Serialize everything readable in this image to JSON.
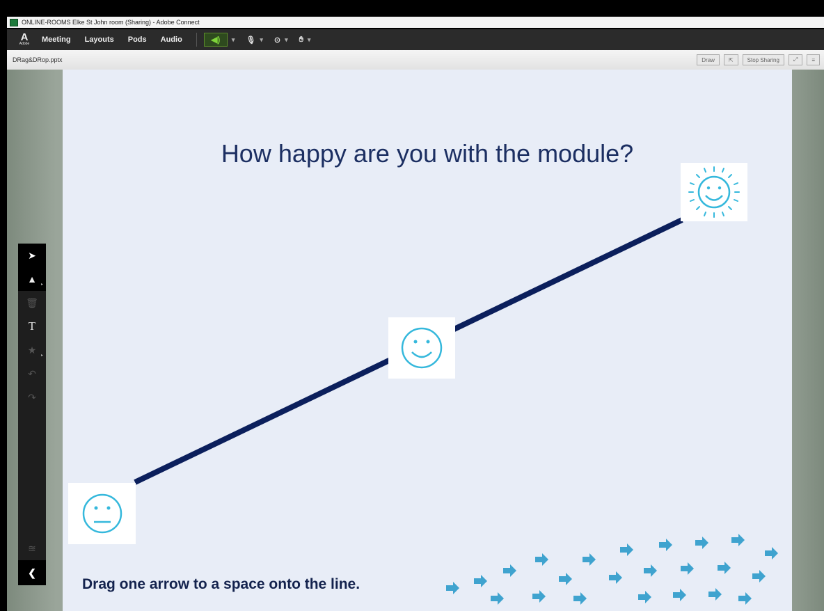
{
  "window": {
    "title": "ONLINE-ROOMS Elke St John room (Sharing) - Adobe Connect"
  },
  "menubar": {
    "logo_text": "Adobe",
    "items": [
      {
        "label": "Meeting"
      },
      {
        "label": "Layouts"
      },
      {
        "label": "Pods"
      },
      {
        "label": "Audio"
      }
    ]
  },
  "pod": {
    "filename": "DRag&DRop.pptx",
    "draw_label": "Draw",
    "stop_sharing_label": "Stop Sharing"
  },
  "slide": {
    "question": "How happy are you with the module?",
    "instruction": "Drag one arrow to a space onto the line.",
    "colors": {
      "line": "#0b1f5c",
      "face": "#35b8dc",
      "arrow": "#3fa3cf",
      "background": "#e8edf7"
    },
    "faces": [
      {
        "name": "neutral",
        "icon": "neutral-face-icon"
      },
      {
        "name": "smile",
        "icon": "smiley-face-icon"
      },
      {
        "name": "sun",
        "icon": "sun-face-icon"
      }
    ],
    "arrow_count": 23
  },
  "tools": [
    {
      "name": "selection-tool",
      "icon": "cursor-icon"
    },
    {
      "name": "marker-tool",
      "icon": "marker-icon"
    },
    {
      "name": "delete-tool",
      "icon": "trash-icon"
    },
    {
      "name": "text-tool",
      "icon": "text-icon",
      "glyph": "T"
    },
    {
      "name": "shape-tool",
      "icon": "star-icon"
    },
    {
      "name": "undo-tool",
      "icon": "undo-icon"
    },
    {
      "name": "redo-tool",
      "icon": "redo-icon"
    },
    {
      "name": "layers-tool",
      "icon": "layers-icon"
    },
    {
      "name": "collapse-toolbar",
      "icon": "chevron-left-icon"
    }
  ]
}
